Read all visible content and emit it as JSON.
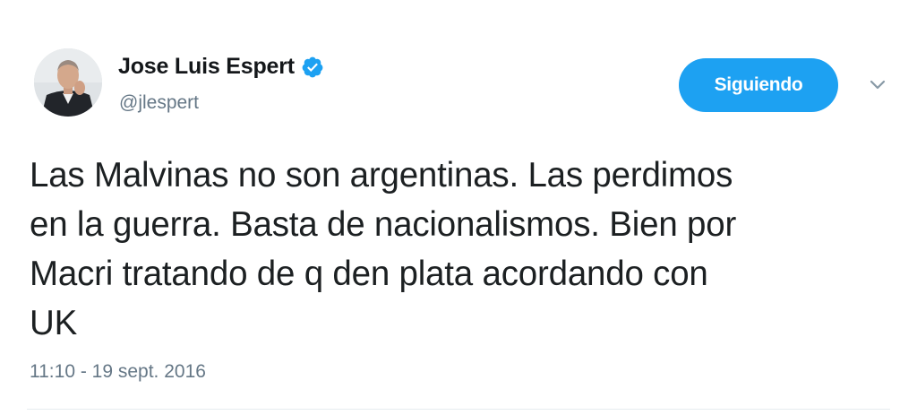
{
  "tweet": {
    "author": {
      "display_name": "Jose Luis Espert",
      "handle": "@jlespert",
      "verified": true,
      "avatar_icon": "profile-photo"
    },
    "follow_button_label": "Siguiendo",
    "menu_icon": "chevron-down-icon",
    "text": "Las Malvinas no son argentinas. Las perdimos\nen la guerra. Basta de nacionalismos. Bien por\nMacri tratando de q den plata acordando con\nUK",
    "timestamp": "11:10 - 19 sept. 2016"
  },
  "colors": {
    "accent": "#1da1f2",
    "secondary_text": "#657786",
    "primary_text": "#14171a"
  }
}
